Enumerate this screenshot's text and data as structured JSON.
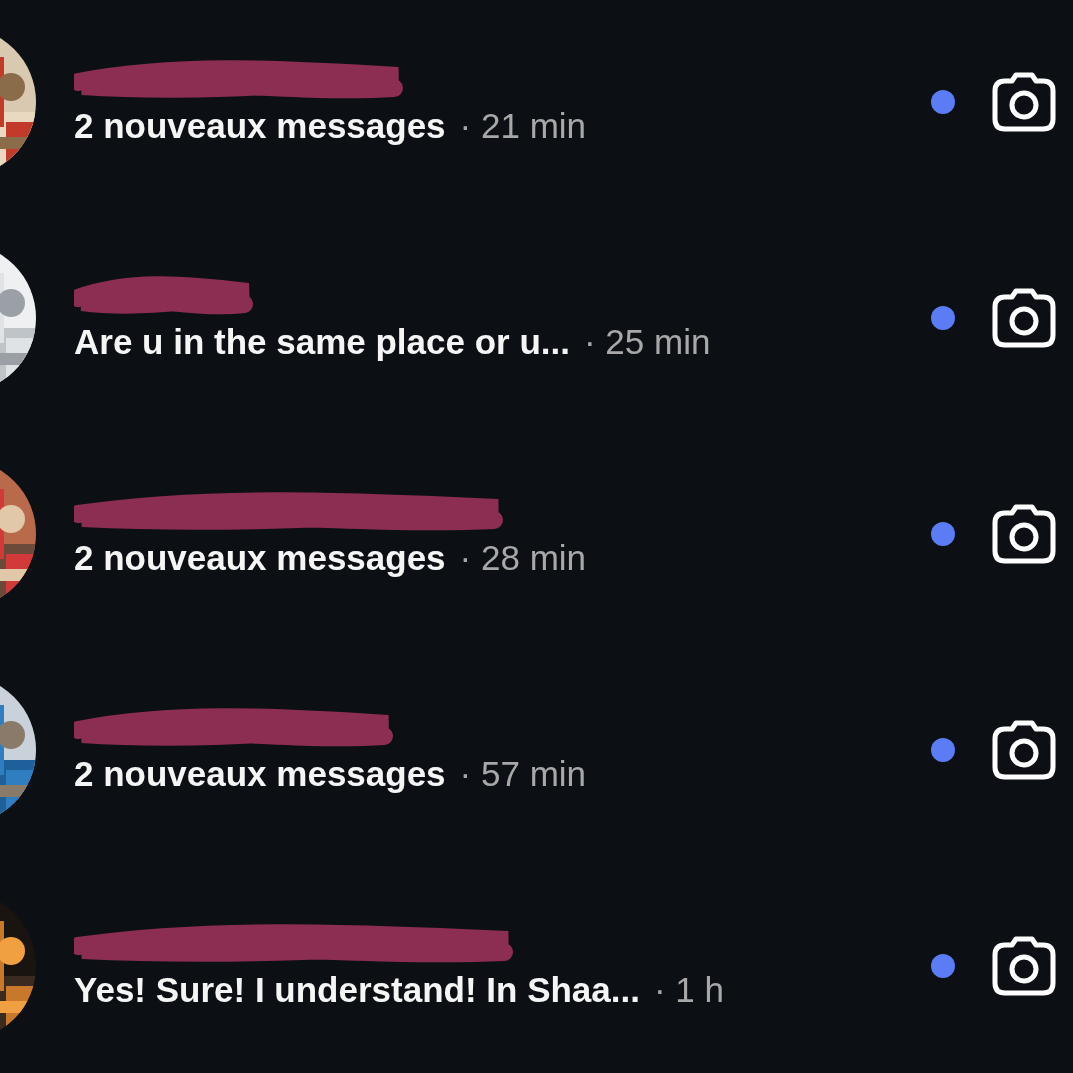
{
  "conversations": [
    {
      "preview": "2 nouveaux messages",
      "time": "· 21 min",
      "unread": true
    },
    {
      "preview": "Are u in the same place or u...",
      "time": "· 25 min",
      "unread": true
    },
    {
      "preview": "2 nouveaux messages",
      "time": "· 28 min",
      "unread": true
    },
    {
      "preview": "2 nouveaux messages",
      "time": "· 57 min",
      "unread": true
    },
    {
      "preview": "Yes! Sure! I understand! In Shaa...",
      "time": "· 1 h",
      "unread": true
    }
  ]
}
